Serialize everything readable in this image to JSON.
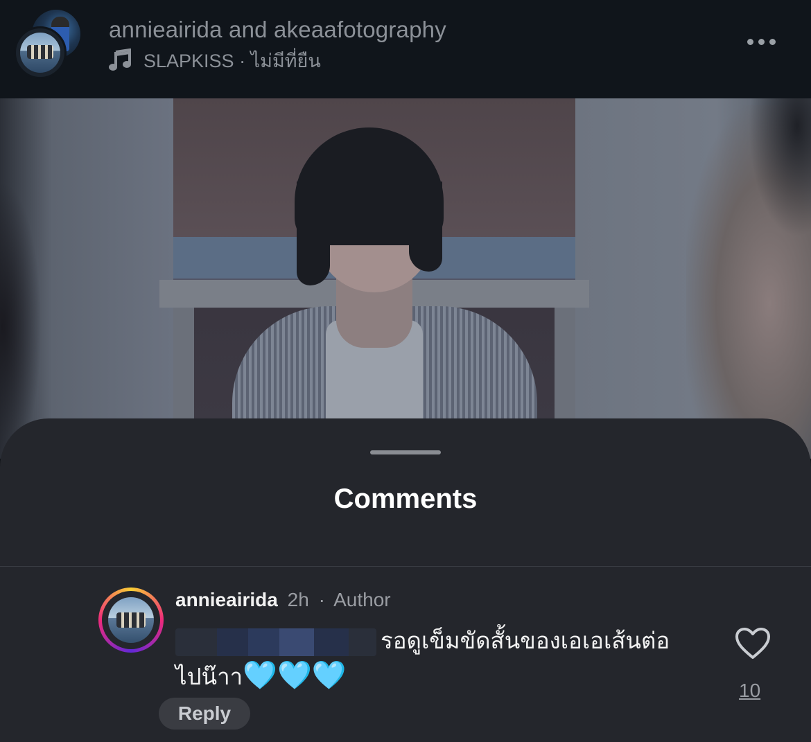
{
  "header": {
    "title": "annieairida and akeaafotography",
    "audio_label": "SLAPKISS · ไม่มีที่ยืน",
    "music_icon": "music-note-icon",
    "more_icon": "more-horizontal-icon"
  },
  "video": {
    "description_icon": "video-frame"
  },
  "comments": {
    "title": "Comments",
    "items": [
      {
        "username": "annieairida",
        "time": "2h",
        "separator": "·",
        "role": "Author",
        "text": "รอดูเข็มขัดสั้นของเอเอเส้นต่อไปน๊าา",
        "text_line1": "รอดูเข็มขัดสั้นของเอเอเส้นต่อ",
        "text_line2": "ไปน๊าา",
        "emoji": "🩵🩵🩵",
        "like_count": "10",
        "reply_label": "Reply",
        "like_icon": "heart-outline-icon"
      }
    ]
  },
  "colors": {
    "background": "#0f1216",
    "sheet": "#24262c",
    "accent_blue_heart": "#7fd6f5"
  }
}
